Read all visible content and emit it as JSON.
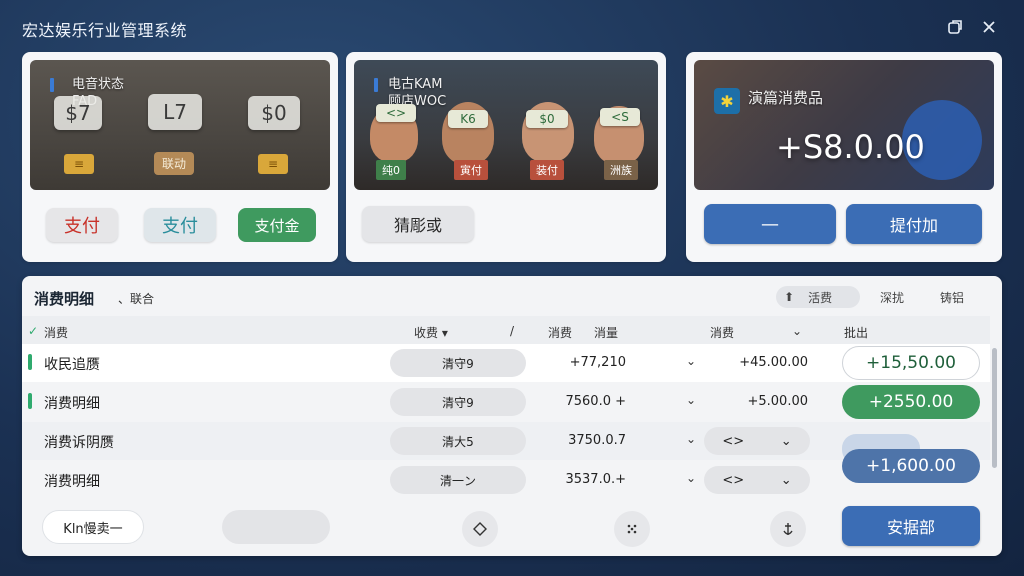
{
  "app": {
    "title": "宏达娱乐行业管理系统"
  },
  "window": {
    "restore_icon": "restore-icon",
    "close_icon": "close-icon"
  },
  "card1": {
    "title_line1": "电音状态",
    "title_line2": "FAD",
    "tags": [
      "$7",
      "L7",
      "$0"
    ],
    "wood_label": "联动",
    "buttons": [
      "支付",
      "支付",
      "支付金"
    ]
  },
  "card2": {
    "title_line1": "电古KAM",
    "title_line2": "顾店WOC",
    "headbands": [
      "<>",
      "K6",
      "$0",
      "<S"
    ],
    "name_tags": [
      "纯0",
      "寅付",
      "装付",
      "洲族"
    ],
    "button": "猜彫或"
  },
  "card3": {
    "title": "演篇消费品",
    "amount": "+S8.0.00",
    "btn_left": "—",
    "btn_right": "提付加"
  },
  "table": {
    "title": "消费明细",
    "subtitle": "、联合",
    "tools": [
      "活费",
      "深扰",
      "铸铝"
    ],
    "headers": {
      "col1": "消费",
      "col2": "收费",
      "col3a": "消费",
      "col3b": "消量",
      "col4": "消费",
      "col5": "批出"
    },
    "rows": [
      {
        "label": "收民追赝",
        "chip": "清守9",
        "num1": "+77,210",
        "num2": "+45.00.00",
        "amount": "+15,50.00",
        "indicator": true
      },
      {
        "label": "消费明细",
        "chip": "清守9",
        "num1": "7560.0 +",
        "num2": "+5.00.00",
        "amount": "+2550.00",
        "indicator": true
      },
      {
        "label": "消费诉阴赝",
        "chip": "清大5",
        "num1": "3750.0.7",
        "stepper": "<>",
        "amount": "",
        "indicator": false
      },
      {
        "label": "消费明细",
        "chip": "清一ン",
        "num1": "3537.0.+",
        "stepper": "<>",
        "amount": "+1,600.00",
        "indicator": false
      }
    ],
    "footer": {
      "left_button": "Kln慢卖一",
      "right_button": "安据部"
    }
  }
}
